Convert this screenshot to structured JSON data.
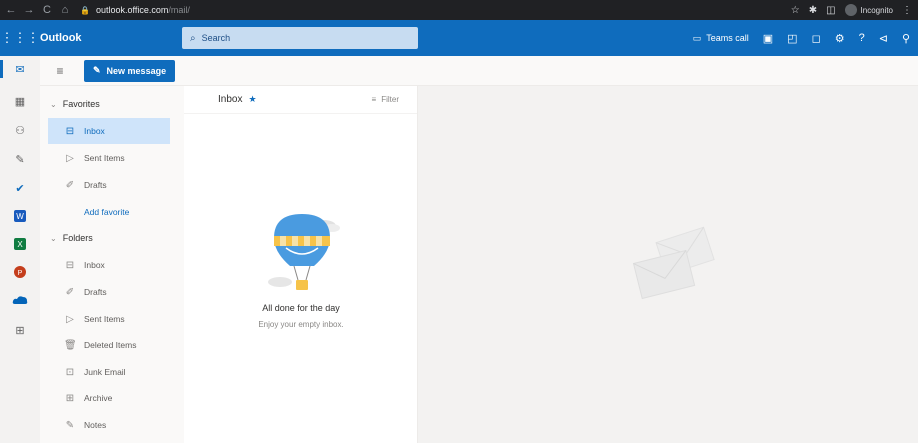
{
  "browser": {
    "url_host": "outlook.office.com",
    "url_path": "/mail/",
    "incognito_label": "Incognito"
  },
  "header": {
    "app_name": "Outlook",
    "search_placeholder": "Search",
    "teams_call_label": "Teams call"
  },
  "toolbar": {
    "new_message_label": "New message"
  },
  "folder_pane": {
    "favorites_label": "Favorites",
    "favorites": [
      {
        "label": "Inbox",
        "icon": "inbox-icon",
        "selected": true
      },
      {
        "label": "Sent Items",
        "icon": "send-icon"
      },
      {
        "label": "Drafts",
        "icon": "pencil-icon"
      }
    ],
    "add_favorite_label": "Add favorite",
    "folders_label": "Folders",
    "folders": [
      {
        "label": "Inbox",
        "icon": "inbox-icon"
      },
      {
        "label": "Drafts",
        "icon": "pencil-icon"
      },
      {
        "label": "Sent Items",
        "icon": "send-icon"
      },
      {
        "label": "Deleted Items",
        "icon": "trash-icon"
      },
      {
        "label": "Junk Email",
        "icon": "junk-icon"
      },
      {
        "label": "Archive",
        "icon": "archive-icon"
      },
      {
        "label": "Notes",
        "icon": "note-icon"
      }
    ]
  },
  "message_list": {
    "title": "Inbox",
    "filter_label": "Filter",
    "empty_title": "All done for the day",
    "empty_subtitle": "Enjoy your empty inbox."
  },
  "colors": {
    "accent": "#0f6cbd",
    "selected_bg": "#cfe4fa",
    "chrome": "#202124"
  }
}
